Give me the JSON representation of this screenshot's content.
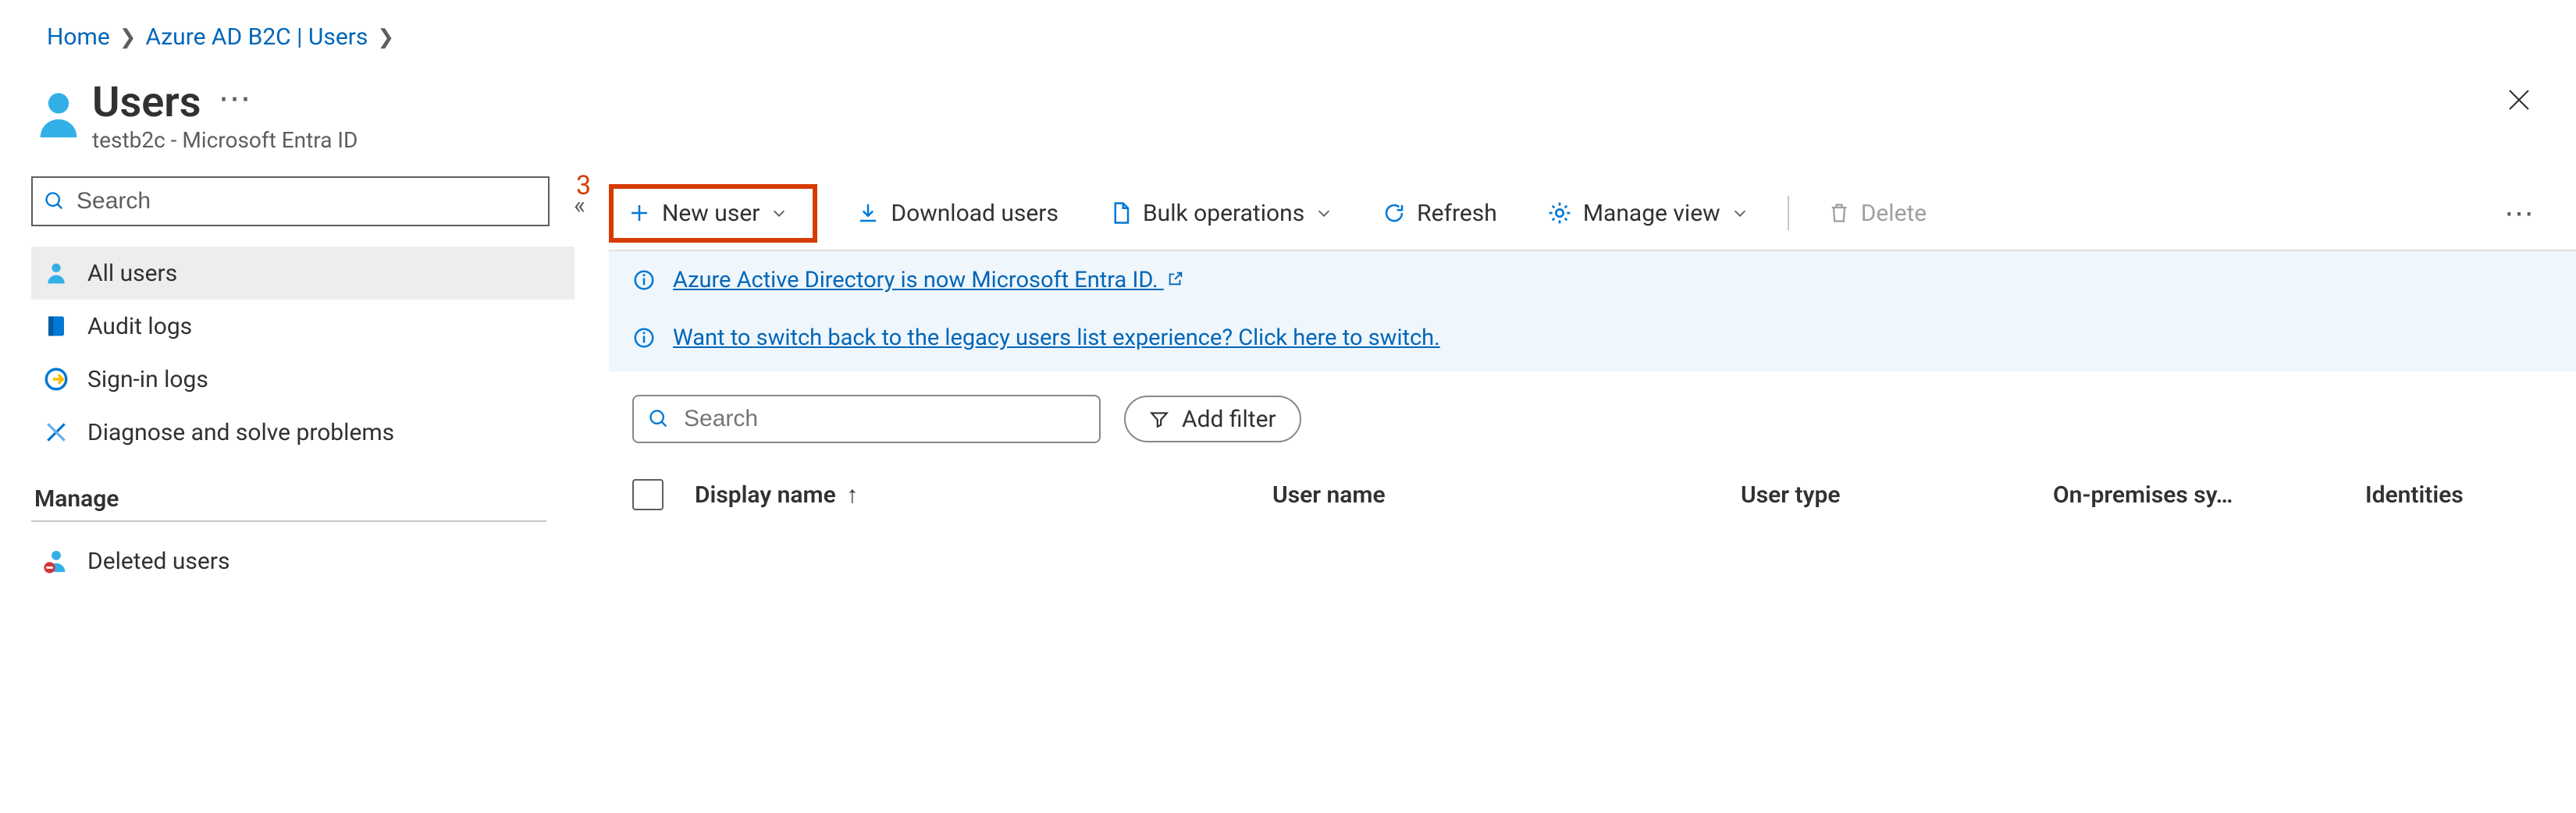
{
  "breadcrumb": {
    "items": [
      {
        "label": "Home"
      },
      {
        "label": "Azure AD B2C | Users"
      }
    ]
  },
  "header": {
    "title": "Users",
    "subtitle": "testb2c - Microsoft Entra ID"
  },
  "sidebar": {
    "search_placeholder": "Search",
    "items": [
      {
        "label": "All users",
        "icon": "user-icon",
        "active": true
      },
      {
        "label": "Audit logs",
        "icon": "book-icon",
        "active": false
      },
      {
        "label": "Sign-in logs",
        "icon": "signin-icon",
        "active": false
      },
      {
        "label": "Diagnose and solve problems",
        "icon": "wrench-icon",
        "active": false
      }
    ],
    "section_label": "Manage",
    "manage_items": [
      {
        "label": "Deleted users",
        "icon": "deleted-user-icon"
      }
    ]
  },
  "annotation": {
    "step3": "3"
  },
  "commandbar": {
    "new_user": "New user",
    "download": "Download users",
    "bulk": "Bulk operations",
    "refresh": "Refresh",
    "manage_view": "Manage view",
    "delete": "Delete"
  },
  "banners": {
    "entra": "Azure Active Directory is now Microsoft Entra ID.",
    "legacy": "Want to switch back to the legacy users list experience? Click here to switch."
  },
  "filters": {
    "search_placeholder": "Search",
    "add_filter": "Add filter"
  },
  "table": {
    "columns": [
      "Display name",
      "User name",
      "User type",
      "On-premises sy…",
      "Identities"
    ],
    "sort_column_index": 0,
    "sort_dir": "asc"
  },
  "colors": {
    "link": "#0066b8",
    "accent": "#0078d4",
    "callout": "#d83b01",
    "bg_banner": "#eff6fc"
  }
}
